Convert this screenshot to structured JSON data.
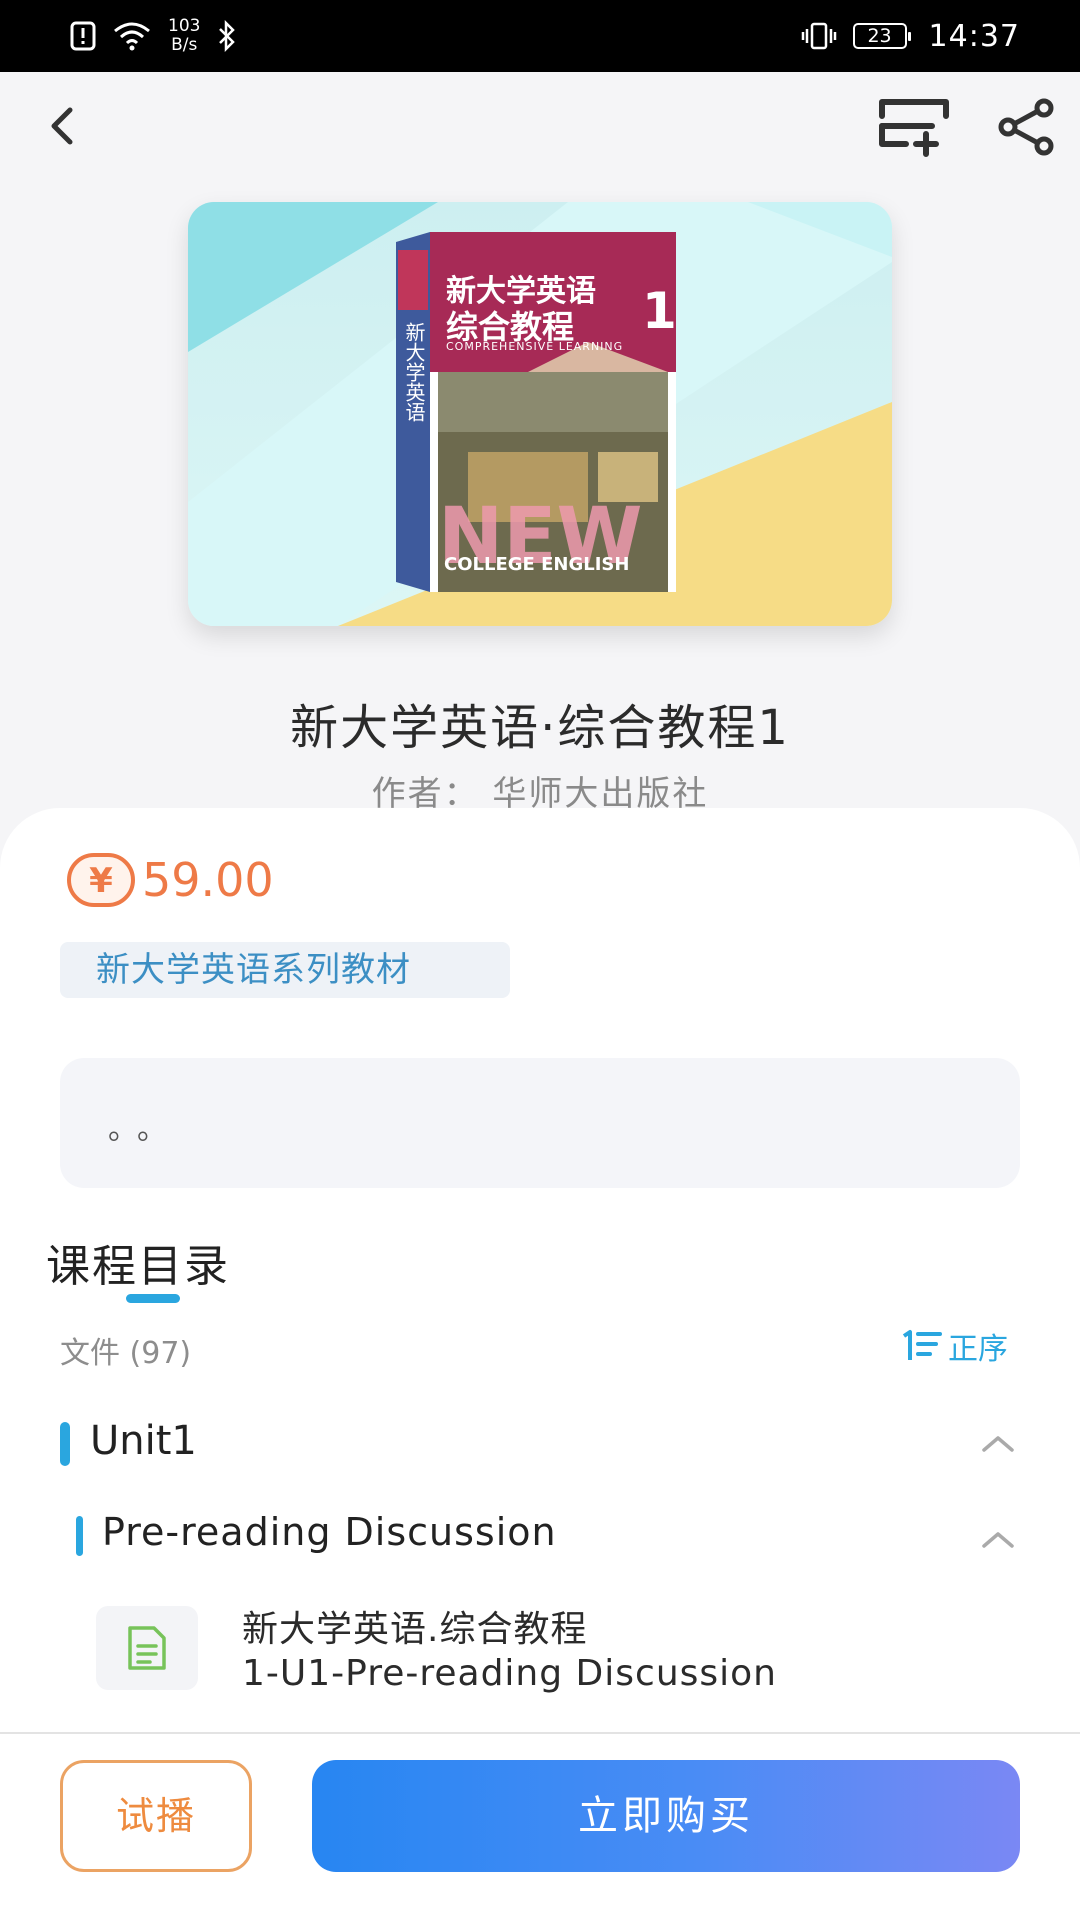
{
  "status_bar": {
    "net_speed_value": "103",
    "net_speed_unit": "B/s",
    "battery_level": "23",
    "time": "14:37"
  },
  "book": {
    "title": "新大学英语·综合教程1",
    "author": "作者：  华师大出版社",
    "cover_art": {
      "spine_text": "新大学英语",
      "title_line1": "新大学英语",
      "title_line2": "综合教程",
      "subtitle": "COMPREHENSIVE LEARNING",
      "big_word": "NEW",
      "small_word": "COLLEGE ENGLISH",
      "volume": "1"
    }
  },
  "pricing": {
    "currency_symbol": "¥",
    "price": "59.00",
    "price_color": "#ee7a47"
  },
  "series_tag": "新大学英语系列教材",
  "description": "。。",
  "catalog": {
    "title": "课程目录",
    "file_count_label": "文件 (97)",
    "sort_label": "正序",
    "unit": {
      "label": "Unit1",
      "section": {
        "label": "Pre-reading Discussion",
        "file": {
          "line1": "新大学英语.综合教程",
          "line2": "1-U1-Pre-reading Discussion"
        }
      }
    }
  },
  "actions": {
    "trial_label": "试播",
    "buy_label": "立即购买"
  },
  "colors": {
    "accent_blue": "#2aa6df",
    "trial_orange": "#ee8b3f",
    "buy_gradient_start": "#2786f2",
    "buy_gradient_end": "#7a88f4"
  }
}
